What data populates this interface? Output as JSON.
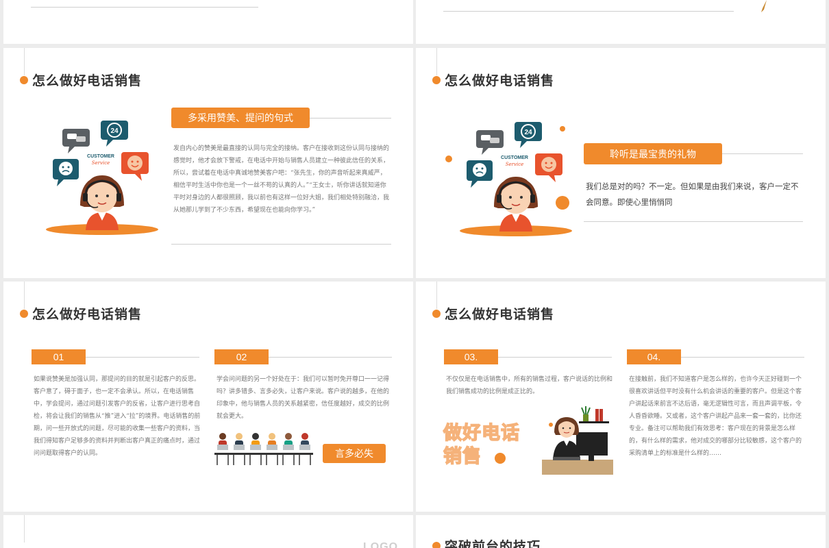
{
  "slides": {
    "s3": {
      "title": "怎么做好电话销售",
      "pill": "多采用赞美、提问的句式",
      "paragraph": "发自内心的赞美是最直接的认同与完全的接纳。客户在接收到这份认同与接纳的感觉时，他才会放下警戒，在电话中开始与销售人员建立一种彼此信任的关系，所以，尝试着在电话中真诚地赞美客户吧：“张先生，你的声音听起来真威严，相信平时生活中你也是一个一丝不苟的认真的人。”“王女士，听你讲话就知道你平时对身边的人都很照顾，我以前也有这样一位好大姐，我们相处特别融洽，我从她那儿学到了不少东西，希望现在也能向你学习。”",
      "customer_service": "CUSTOMER",
      "service_script": "Service",
      "badge_24": "24"
    },
    "s4": {
      "title": "怎么做好电话销售",
      "pill": "聆听是最宝贵的礼物",
      "paragraph": "我们总是对的吗？不一定。但如果是由我们来说，客户一定不会同意。即使心里悄悄同",
      "customer_service": "CUSTOMER",
      "service_script": "Service",
      "badge_24": "24"
    },
    "s5": {
      "title": "怎么做好电话销售",
      "item1": {
        "num": "01",
        "text": "如果说赞美是加强认同，那提问的目的就是引起客户的反思。客户意了，碍于面子，也一定不会承认。所以，在电话销售中，学会提问，通过问题引发客户的反省，让客户进行思考自检，将会让我们的销售从“推”进入“拉”的境界。电话销售的前期，问一些开放式的问题，尽可能的收集一些客户的资料，当我们得知客户足够多的资料并判断出客户真正的痛点时，通过问问题取得客户的认同。"
      },
      "item2": {
        "num": "02",
        "text": "学会问问题的另一个好处在于：我们可以暂时免开尊口一一记得吗？讲多错多、言多必失，让客户来说。客户说的越多，在他的印象中，他与销售人员的关系越紧密，信任度越好，成交的比例就会更大。"
      },
      "button": "言多必失"
    },
    "s6": {
      "title": "怎么做好电话销售",
      "item3": {
        "num": "03.",
        "text": "不仅仅是在电话销售中，所有的销售过程，客户说话的比例和我们销售成功的比例是成正比的。"
      },
      "item4": {
        "num": "04.",
        "text": "在接触前，我们不知道客户是怎么样的，也许今天正好碰到一个很喜欢讲话但平时没有什么机会讲话的重要的客户。但是这个客户讲起话来前言不达后语，毫无逻辑性可言，而且声调平板，令人昏昏欲睡。又或者，这个客户讲起产品来一套一套的，比你还专业。备注可以帮助我们有效思考：客户现在的背景是怎么样的，有什么样的需求，他对成交的哪部分比较敏感，这个客户的采购清单上的标准是什么样的……"
      },
      "big_line1": "做好电话",
      "big_line2": "销售"
    },
    "s8": {
      "title": "突破前台的技巧"
    },
    "s7": {
      "logo": "LOGO"
    }
  },
  "colors": {
    "accent": "#f08a2c",
    "title": "#333333",
    "body_text": "#777777",
    "teal": "#1d5c6e"
  }
}
